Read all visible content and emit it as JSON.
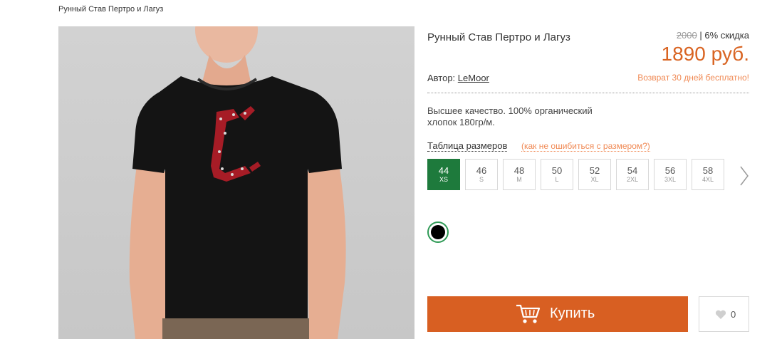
{
  "breadcrumb": "Рунный Став Пертро и Лагуз",
  "product": {
    "title": "Рунный Став Пертро и Лагуз",
    "price_old": "2000",
    "discount": "| 6% скидка",
    "price_now": "1890 руб.",
    "author_label": "Автор:",
    "author_name": "LeMoor",
    "refund": "Возврат 30 дней бесплатно!",
    "description": "Высшее качество. 100% органический хлопок 180гр/м."
  },
  "sizes_section": {
    "table_link": "Таблица размеров",
    "hint_link": "(как не ошибиться с размером?)",
    "items": [
      {
        "num": "44",
        "label": "XS",
        "active": true
      },
      {
        "num": "46",
        "label": "S",
        "active": false
      },
      {
        "num": "48",
        "label": "M",
        "active": false
      },
      {
        "num": "50",
        "label": "L",
        "active": false
      },
      {
        "num": "52",
        "label": "XL",
        "active": false
      },
      {
        "num": "54",
        "label": "2XL",
        "active": false
      },
      {
        "num": "56",
        "label": "3XL",
        "active": false
      },
      {
        "num": "58",
        "label": "4XL",
        "active": false
      }
    ]
  },
  "color": {
    "selected": "#000000"
  },
  "actions": {
    "buy_label": "Купить",
    "like_count": "0"
  },
  "colors": {
    "accent": "#d85f22",
    "active_size": "#1e7a3c",
    "link_orange": "#f08a55"
  }
}
